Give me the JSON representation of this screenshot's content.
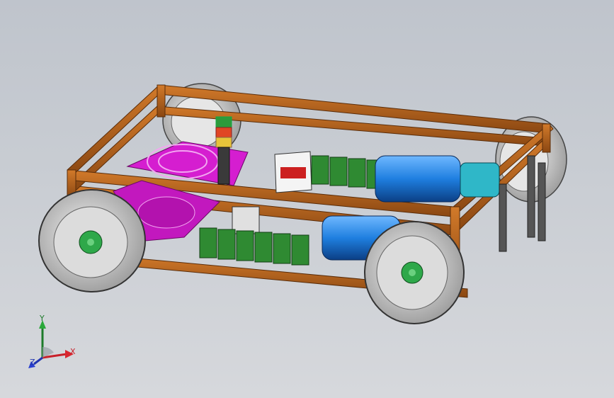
{
  "viewport": {
    "background_top": "#bfc4cc",
    "background_bottom": "#d6d8dc"
  },
  "model": {
    "components": [
      "frame",
      "wheel-front-left",
      "wheel-front-right",
      "wheel-rear-left",
      "wheel-rear-right",
      "cooling-fan",
      "signal-tower-light",
      "display-panel",
      "terminal-blocks",
      "motor-upper",
      "motor-lower",
      "tensioner-brackets"
    ],
    "colors": {
      "frame": "#b5651d",
      "fan": "#d51ed0",
      "motor": "#1f7fe0",
      "gearbox": "#2fb7c8",
      "terminal": "#2f8a32",
      "tire": "#e8e8e8",
      "hub": "#2ea84a"
    }
  },
  "triad": {
    "x_label": "X",
    "y_label": "Y",
    "z_label": "Z",
    "x_color": "#c8202a",
    "y_color": "#1d7a2a",
    "z_color": "#2236b0"
  }
}
